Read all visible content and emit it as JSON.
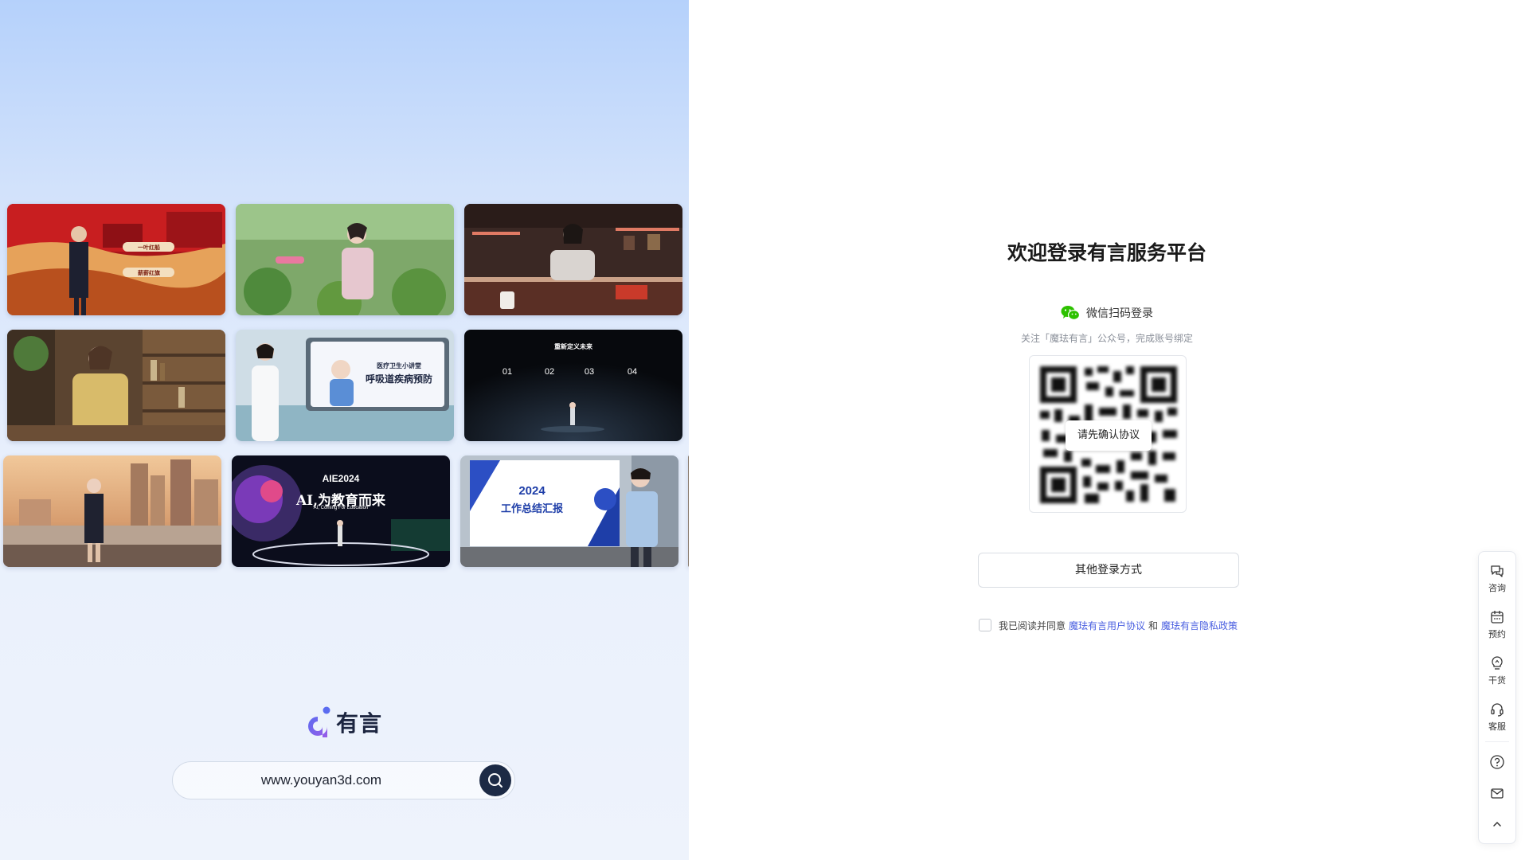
{
  "showcase": {
    "thumbnails": [
      {
        "name": "red-palace-presenter",
        "texts": [
          "一叶红船",
          "薪薪红旗"
        ]
      },
      {
        "name": "garden-presenter",
        "texts": []
      },
      {
        "name": "studio-presenter",
        "texts": []
      },
      {
        "name": "library-presenter",
        "texts": []
      },
      {
        "name": "medical-lecture",
        "texts": [
          "医疗卫生小讲堂",
          "呼吸道疾病预防"
        ]
      },
      {
        "name": "stage-dark",
        "texts": [
          "重新定义未来",
          "01",
          "02",
          "03",
          "04"
        ]
      },
      {
        "name": "city-rooftop",
        "texts": []
      },
      {
        "name": "aie-conference",
        "texts": [
          "AIE2024",
          "AI,为教育而来",
          "AI, Coming For Education"
        ]
      },
      {
        "name": "year-report",
        "texts": [
          "2024",
          "工作总结汇报"
        ]
      }
    ],
    "logo_text": "有言",
    "url": "www.youyan3d.com"
  },
  "login": {
    "title": "欢迎登录有言服务平台",
    "wechat_label": "微信扫码登录",
    "hint": "关注「魔珐有言」公众号，完成账号绑定",
    "qr_overlay": "请先确认协议",
    "other_login": "其他登录方式",
    "agree_prefix": "我已阅读并同意",
    "agree_link_1": "魔珐有言用户协议",
    "agree_and": "和",
    "agree_link_2": "魔珐有言隐私政策"
  },
  "side_toolbar": {
    "items": [
      {
        "icon": "chat-icon",
        "label": "咨询"
      },
      {
        "icon": "calendar-icon",
        "label": "预约"
      },
      {
        "icon": "lightbulb-icon",
        "label": "干货"
      },
      {
        "icon": "headset-icon",
        "label": "客服"
      },
      {
        "icon": "help-icon",
        "label": ""
      },
      {
        "icon": "mail-icon",
        "label": ""
      },
      {
        "icon": "chevron-up-icon",
        "label": ""
      }
    ]
  },
  "colors": {
    "link": "#4a5fe0",
    "wechat_green": "#2dc100",
    "url_button": "#1c2a45"
  }
}
